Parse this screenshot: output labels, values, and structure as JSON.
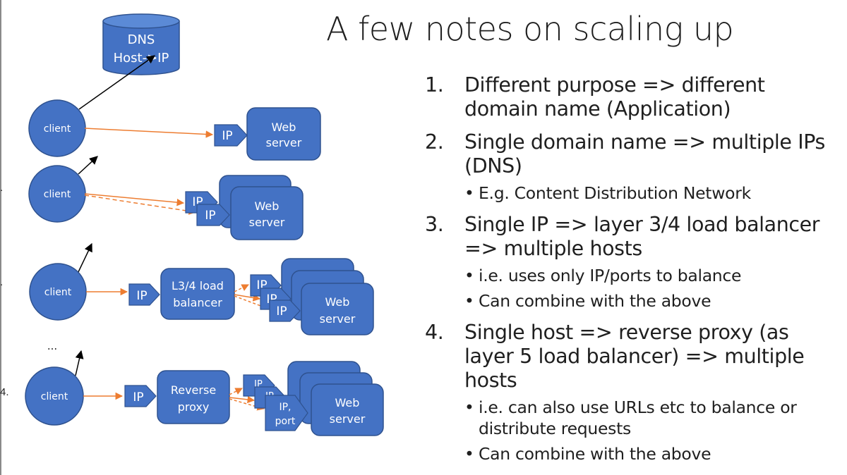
{
  "title": "A few notes on scaling up",
  "notes": [
    {
      "num": "1.",
      "text": "Different purpose => different domain name (Application)",
      "subs": []
    },
    {
      "num": "2.",
      "text": "Single domain name => multiple IPs (DNS)",
      "subs": [
        "E.g. Content Distribution Network"
      ]
    },
    {
      "num": "3.",
      "text": "Single IP => layer 3/4 load balancer => multiple hosts",
      "subs": [
        "i.e. uses only IP/ports to balance",
        "Can combine with the above"
      ]
    },
    {
      "num": "4.",
      "text": "Single host => reverse proxy (as layer 5 load balancer) => multiple hosts",
      "subs": [
        "i.e. can also use URLs etc to balance or distribute requests",
        "Can combine with the above"
      ]
    }
  ],
  "diagram": {
    "dns": {
      "line1": "DNS",
      "line2": "Host->IP"
    },
    "client": "client",
    "ip": "IP",
    "ip_partial": "IP",
    "ip_port": {
      "line1": "IP,",
      "line2": "port"
    },
    "web_server": {
      "line1": "Web",
      "line2": "server"
    },
    "load_balancer": {
      "line1": "L3/4 load",
      "line2": "balancer"
    },
    "reverse_proxy": {
      "line1": "Reverse",
      "line2": "proxy"
    },
    "ellipsis": "...",
    "edge_markers": [
      ".",
      ".",
      "4."
    ]
  },
  "colors": {
    "shape_fill": "#4472c4",
    "shape_stroke": "#2f528f",
    "arrow_orange": "#ed7d31",
    "arrow_black": "#000000",
    "text": "#1f1f1f"
  }
}
